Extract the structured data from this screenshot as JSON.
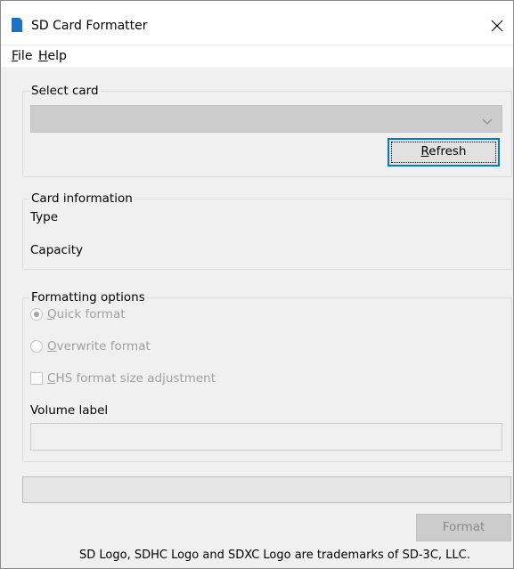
{
  "window": {
    "title": "SD Card Formatter",
    "icon": "sd-card-icon",
    "close_icon": "close-icon"
  },
  "menu": {
    "file": {
      "mnemonic": "F",
      "rest": "ile"
    },
    "help": {
      "mnemonic": "H",
      "rest": "elp"
    }
  },
  "select_card": {
    "legend": "Select card",
    "selected_value": "",
    "refresh": {
      "mnemonic": "R",
      "rest": "efresh"
    }
  },
  "card_info": {
    "legend": "Card information",
    "type_label": "Type",
    "capacity_label": "Capacity"
  },
  "formatting": {
    "legend": "Formatting options",
    "quick": {
      "mnemonic": "Q",
      "rest": "uick format",
      "checked": true,
      "enabled": false
    },
    "overwrite": {
      "mnemonic": "O",
      "rest": "verwrite format",
      "checked": false,
      "enabled": false
    },
    "chs": {
      "mnemonic": "C",
      "rest": "HS format size adjustment",
      "checked": false,
      "enabled": false
    },
    "volume_label": "Volume label",
    "volume_value": ""
  },
  "progress": {
    "value": 0
  },
  "format_button": "Format",
  "footer": "SD Logo, SDHC Logo and SDXC Logo are trademarks of SD-3C, LLC.",
  "colors": {
    "accent": "#0078d7",
    "sd_icon": "#1a73c8",
    "progress_fill": "#06b025",
    "disabled_text": "#a0a0a0"
  }
}
